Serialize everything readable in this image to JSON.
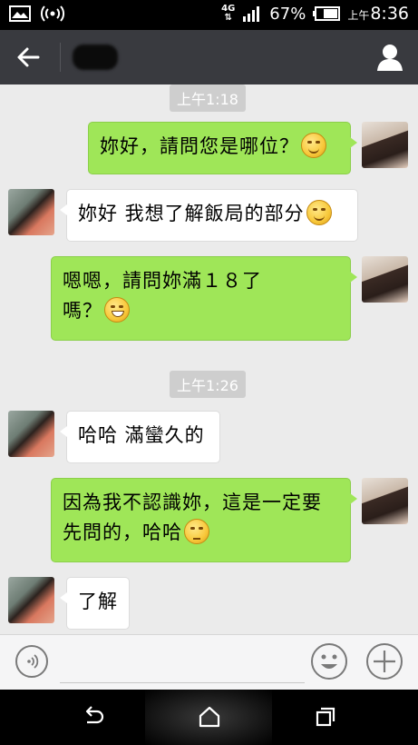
{
  "status_bar": {
    "network_type": "4G",
    "battery_percent": "67%",
    "time_prefix": "上午",
    "time": "8:36",
    "icons": [
      "image-icon",
      "wifi-hotspot-icon",
      "signal-icon",
      "battery-icon"
    ]
  },
  "title_bar": {
    "back_icon": "arrow-left-icon",
    "contact_name": "",
    "profile_icon": "person-icon"
  },
  "messages": [
    {
      "type": "time",
      "text": "上午1:18"
    },
    {
      "type": "sent",
      "text": "妳好，請問您是哪位？",
      "emoji": "smile"
    },
    {
      "type": "received",
      "text": "妳好 我想了解飯局的部分",
      "emoji": "smile"
    },
    {
      "type": "sent",
      "line1": "嗯嗯，請問妳滿１８了",
      "line2": "嗎？",
      "emoji": "grin"
    },
    {
      "type": "time",
      "text": "上午1:26"
    },
    {
      "type": "received",
      "text": "哈哈 滿蠻久的"
    },
    {
      "type": "sent",
      "line1": "因為我不認識妳，這是一定要",
      "line2": "先問的，哈哈",
      "emoji": "think"
    },
    {
      "type": "received",
      "text": "了解"
    }
  ],
  "input_bar": {
    "voice_icon": "voice-icon",
    "emoji_icon": "smiley-icon",
    "plus_icon": "plus-icon",
    "placeholder": ""
  },
  "nav_bar": {
    "icons": [
      "back-nav-icon",
      "home-icon",
      "recents-icon"
    ]
  },
  "colors": {
    "sent_bubble": "#9fe658",
    "received_bubble": "#ffffff",
    "title_bar": "#393a3f",
    "chat_bg": "#ebebeb"
  }
}
